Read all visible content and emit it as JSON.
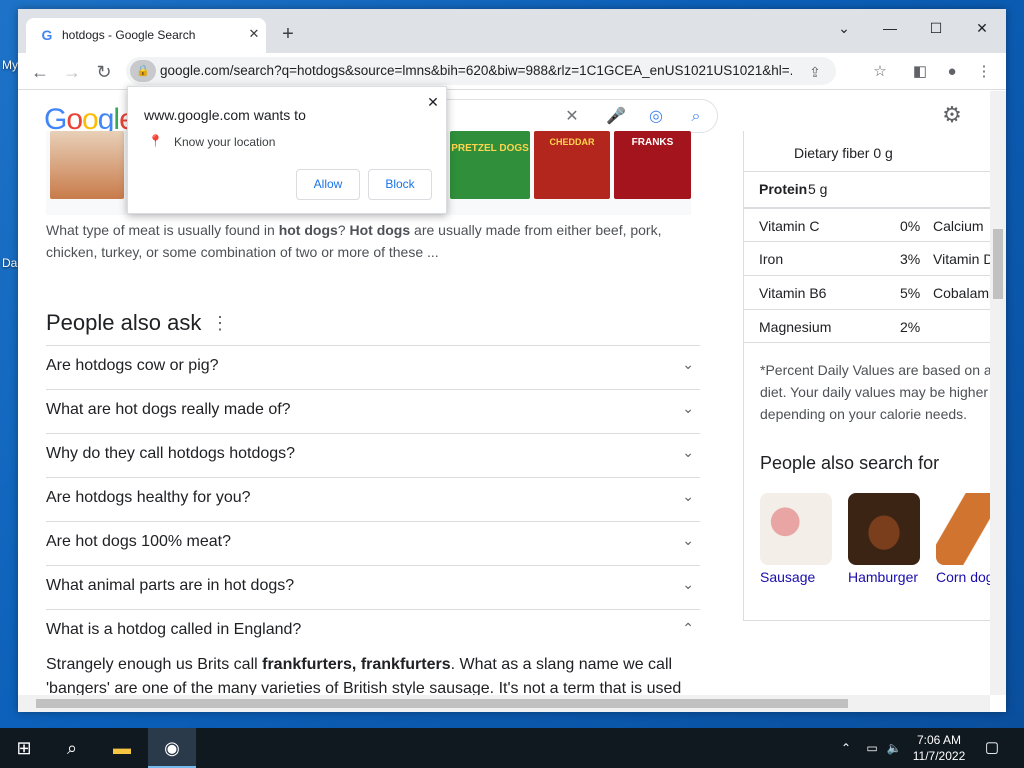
{
  "desktop": {
    "icon_labels": [
      "My",
      "Da"
    ]
  },
  "browser": {
    "tab_title": "hotdogs - Google Search",
    "tab_favicon": "google-g-icon",
    "url": "google.com/search?q=hotdogs&source=lmns&bih=620&biw=988&rlz=1C1GCEA_enUS1021US1021&hl=...",
    "window_controls": {
      "minimize": "—",
      "maximize": "☐",
      "close": "✕",
      "tabsearch": "⌄"
    }
  },
  "google": {
    "logo": "Google",
    "snippet_parts": [
      {
        "text": "What type of meat is usually found in ",
        "bold": false
      },
      {
        "text": "hot dogs",
        "bold": true
      },
      {
        "text": "? ",
        "bold": false
      },
      {
        "text": "Hot dogs",
        "bold": true
      },
      {
        "text": " are usually made from either beef, pork, chicken, turkey, or some combination of two or more of these ...",
        "bold": false
      }
    ],
    "product_labels": [
      "PRETZEL DOGS",
      "CHEDDAR",
      "FRANKS"
    ],
    "paa_heading": "People also ask",
    "paa": [
      "Are hotdogs cow or pig?",
      "What are hot dogs really made of?",
      "Why do they call hotdogs hotdogs?",
      "Are hotdogs healthy for you?",
      "Are hot dogs 100% meat?",
      "What animal parts are in hot dogs?",
      "What is a hotdog called in England?"
    ],
    "answer_parts": [
      {
        "text": "Strangely enough us Brits call ",
        "bold": false
      },
      {
        "text": "frankfurters, frankfurters",
        "bold": true
      },
      {
        "text": ". What as a slang name we call 'bangers' are one of the many varieties of British style sausage. It's not a term that is used",
        "bold": false
      }
    ]
  },
  "nutrition": {
    "fiber": "Dietary fiber 0 g",
    "protein_label": "Protein",
    "protein_value": "5 g",
    "rows": [
      {
        "name": "Vitamin C",
        "pct": "0%",
        "name2": "Calcium"
      },
      {
        "name": "Iron",
        "pct": "3%",
        "name2": "Vitamin D"
      },
      {
        "name": "Vitamin B6",
        "pct": "5%",
        "name2": "Cobalamin"
      },
      {
        "name": "Magnesium",
        "pct": "2%",
        "name2": ""
      }
    ],
    "note": "*Percent Daily Values are based on a diet. Your daily values may be higher depending on your calorie needs.",
    "pasf_heading": "People also search for",
    "pasf": [
      "Sausage",
      "Hamburger",
      "Corn dog"
    ]
  },
  "popup": {
    "title": "www.google.com wants to",
    "permission": "Know your location",
    "allow": "Allow",
    "block": "Block"
  },
  "taskbar": {
    "time": "7:06 AM",
    "date": "11/7/2022"
  },
  "colors": {
    "accent": "#1a73e8",
    "link": "#1a0dab",
    "taskbar": "#101820"
  }
}
